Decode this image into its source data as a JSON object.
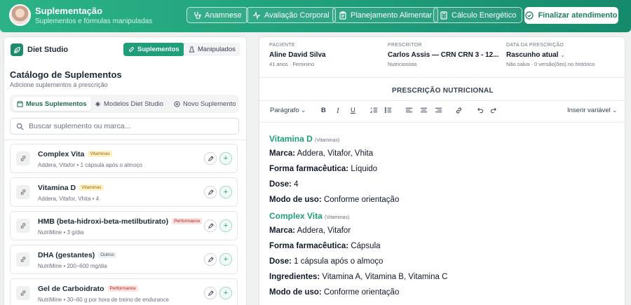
{
  "header": {
    "title": "Suplementação",
    "subtitle": "Suplementos e fórmulas manipuladas",
    "nav": [
      {
        "label": "Anamnese",
        "icon": "stethoscope-icon"
      },
      {
        "label": "Avaliação Corporal",
        "icon": "activity-icon"
      },
      {
        "label": "Planejamento Alimentar",
        "icon": "clipboard-icon"
      },
      {
        "label": "Cálculo Energético",
        "icon": "calculator-icon"
      }
    ],
    "finish_label": "Finalizar atendimento"
  },
  "left": {
    "brand": "Diet Studio",
    "segments": [
      "Suplementos",
      "Manipulados"
    ],
    "catalog_title": "Catálogo de Suplementos",
    "catalog_subtitle": "Adicione suplementos à prescrição",
    "tabs": [
      "Meus Suplementos",
      "Modelos Diet Studio",
      "Novo Suplemento"
    ],
    "search_placeholder": "Buscar suplemento ou marca...",
    "items": [
      {
        "name": "Complex Vita",
        "tag": "Vitaminas",
        "meta": "Addera, Vitafor • 1 cápsula após o almoço"
      },
      {
        "name": "Vitamina D",
        "tag": "Vitaminas",
        "meta": "Addera, Vitafor, Vhita • 4"
      },
      {
        "name": "HMB (beta-hidroxi-beta-metilbutirato)",
        "tag": "Performance",
        "meta": "NutriMine • 3 g/dia"
      },
      {
        "name": "DHA (gestantes)",
        "tag": "Outros",
        "meta": "NutriMine • 200–600 mg/dia"
      },
      {
        "name": "Gel de Carboidrato",
        "tag": "Performance",
        "meta": "NutriMine • 30–60 g por hora de treino de endurance"
      }
    ]
  },
  "right": {
    "patient_label": "PACIENTE",
    "patient_name": "Aline David Silva",
    "patient_sub": "41 anos · Feminino",
    "prescriber_label": "PRESCRITOR",
    "prescriber_name": "Carlos Assis — CRN CRN 3 - 12...",
    "prescriber_sub": "Nutricionista",
    "date_label": "DATA DA PRESCRIÇÃO",
    "date_value": "Rascunho atual",
    "date_sub": "Não salva · 0 versão(ões) no histórico",
    "doc_title": "PRESCRIÇÃO NUTRICIONAL",
    "toolbar": {
      "paragraph": "Parágrafo",
      "insert_var": "Inserir variável"
    },
    "content": {
      "s1_title": "Vitamina D",
      "s1_cat": "(Vitaminas)",
      "marca_label": "Marca:",
      "s1_marca": "Addera, Vitafor, Vhita",
      "forma_label": "Forma farmacêutica:",
      "s1_forma": "Líquido",
      "dose_label": "Dose:",
      "s1_dose": "4",
      "modo_label": "Modo de uso:",
      "s1_modo": "Conforme orientação",
      "s2_title": "Complex Vita",
      "s2_cat": "(Vitaminas)",
      "s2_marca": "Addera, Vitafor",
      "s2_forma": "Cápsula",
      "s2_dose": "1 cápsula após o almoço",
      "ing_label": "Ingredientes:",
      "s2_ing": "Vitamina A, Vitamina B, Vitamina C",
      "s2_modo": "Conforme orientação"
    }
  },
  "colors": {
    "accent": "#1f9e7a",
    "header_start": "#2bb387",
    "header_end": "#168a6c",
    "vitamin_tag_bg": "#fdf3c7",
    "vitamin_tag_fg": "#a16207",
    "performance_tag_bg": "#fde2e2",
    "performance_tag_fg": "#b91c1c",
    "other_tag_bg": "#eef0f3",
    "other_tag_fg": "#4b5563"
  }
}
